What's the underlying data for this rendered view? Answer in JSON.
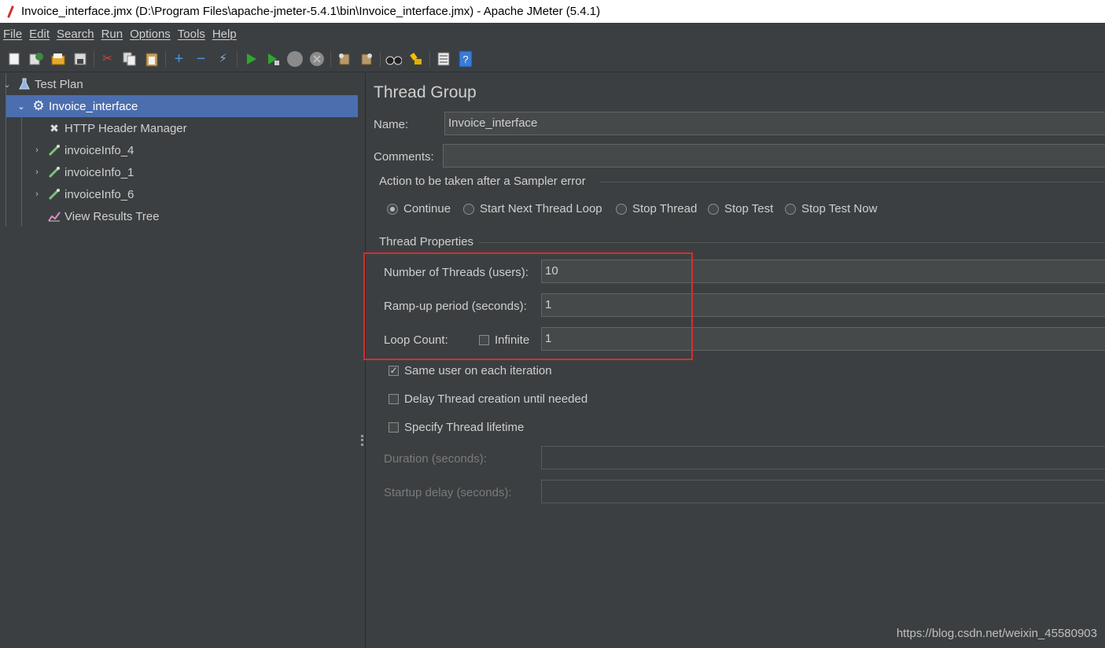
{
  "window": {
    "title": "Invoice_interface.jmx (D:\\Program Files\\apache-jmeter-5.4.1\\bin\\Invoice_interface.jmx) - Apache JMeter (5.4.1)"
  },
  "menu": [
    "File",
    "Edit",
    "Search",
    "Run",
    "Options",
    "Tools",
    "Help"
  ],
  "toolbar": {
    "icons": [
      "new-icon",
      "templates-icon",
      "open-icon",
      "save-icon",
      "cut-icon",
      "copy-icon",
      "paste-icon",
      "expand-icon",
      "collapse-icon",
      "toggle-icon",
      "start-icon",
      "start-no-pauses-icon",
      "stop-icon",
      "shutdown-icon",
      "clear-icon",
      "clear-all-icon",
      "search-icon",
      "reset-search-icon",
      "function-helper-icon",
      "help-icon"
    ]
  },
  "tree": {
    "items": [
      {
        "label": "Test Plan",
        "icon": "flask-icon"
      },
      {
        "label": "Invoice_interface",
        "icon": "gear-icon",
        "selected": true
      },
      {
        "label": "HTTP Header Manager",
        "icon": "tools-icon"
      },
      {
        "label": "invoiceInfo_4",
        "icon": "pipette-icon"
      },
      {
        "label": "invoiceInfo_1",
        "icon": "pipette-icon"
      },
      {
        "label": "invoiceInfo_6",
        "icon": "pipette-icon"
      },
      {
        "label": "View Results Tree",
        "icon": "chart-icon"
      }
    ]
  },
  "panel": {
    "title": "Thread Group",
    "name_label": "Name:",
    "name_value": "Invoice_interface",
    "comments_label": "Comments:",
    "comments_value": "",
    "sampler_error": {
      "title": "Action to be taken after a Sampler error",
      "options": [
        "Continue",
        "Start Next Thread Loop",
        "Stop Thread",
        "Stop Test",
        "Stop Test Now"
      ],
      "selected": "Continue"
    },
    "thread_props": {
      "title": "Thread Properties",
      "threads_label": "Number of Threads (users):",
      "threads_value": "10",
      "rampup_label": "Ramp-up period (seconds):",
      "rampup_value": "1",
      "loop_label": "Loop Count:",
      "infinite_label": "Infinite",
      "infinite_checked": false,
      "loop_value": "1",
      "same_user_label": "Same user on each iteration",
      "same_user_checked": true,
      "delay_label": "Delay Thread creation until needed",
      "delay_checked": false,
      "lifetime_label": "Specify Thread lifetime",
      "lifetime_checked": false,
      "duration_label": "Duration (seconds):",
      "duration_value": "",
      "startup_label": "Startup delay (seconds):",
      "startup_value": ""
    }
  },
  "watermark": "https://blog.csdn.net/weixin_45580903",
  "colors": {
    "background": "#3c3f41",
    "selection": "#4b6eaf",
    "highlight": "#d32f2f"
  }
}
